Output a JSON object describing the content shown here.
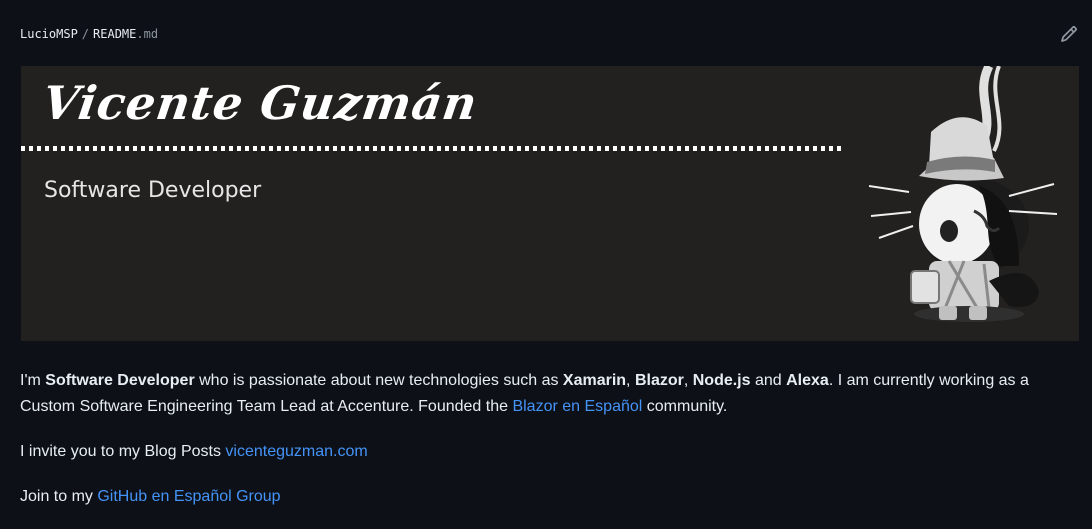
{
  "breadcrumb": {
    "owner": "LucioMSP",
    "separator": "/",
    "filename": "README",
    "extension": ".md"
  },
  "banner": {
    "name": "Vicente Guzmán",
    "role": "Software Developer"
  },
  "readme": {
    "p1": {
      "t1": "I'm ",
      "b1": "Software Developer",
      "t2": " who is passionate about new technologies such as ",
      "b2": "Xamarin",
      "t3": ", ",
      "b3": "Blazor",
      "t4": ", ",
      "b4": "Node.js",
      "t5": " and ",
      "b5": "Alexa",
      "t6": ". I am currently working as a Custom Software Engineering Team Lead at Accenture. Founded the ",
      "link": "Blazor en Español",
      "t7": " community."
    },
    "p2": {
      "t1": "I invite you to my Blog Posts ",
      "link": "vicenteguzman.com"
    },
    "p3": {
      "t1": "Join to my ",
      "link": "GitHub en Español Group"
    }
  },
  "icons": {
    "edit": "pencil-icon",
    "mascot": "octocat-detective-image"
  },
  "colors": {
    "background": "#0d1117",
    "link": "#4493f8",
    "banner": "#232020"
  }
}
